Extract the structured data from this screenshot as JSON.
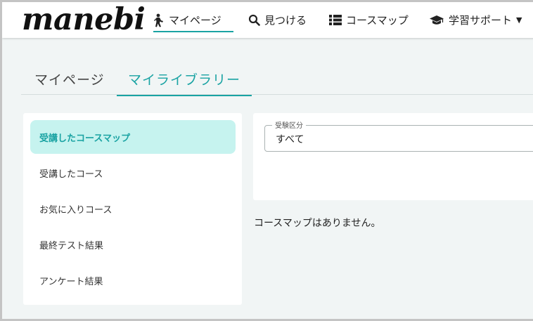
{
  "header": {
    "logo": "manebi",
    "nav": [
      {
        "label": "マイページ",
        "icon": "person-walking-icon",
        "active": true
      },
      {
        "label": "見つける",
        "icon": "search-icon",
        "active": false
      },
      {
        "label": "コースマップ",
        "icon": "list-icon",
        "active": false
      },
      {
        "label": "学習サポート",
        "icon": "graduation-cap-icon",
        "active": false,
        "dropdown": true
      }
    ]
  },
  "tabs": [
    {
      "label": "マイページ",
      "active": false
    },
    {
      "label": "マイライブラリー",
      "active": true
    }
  ],
  "sidebar": {
    "items": [
      {
        "label": "受講したコースマップ",
        "active": true
      },
      {
        "label": "受講したコース",
        "active": false
      },
      {
        "label": "お気に入りコース",
        "active": false
      },
      {
        "label": "最終テスト結果",
        "active": false
      },
      {
        "label": "アンケート結果",
        "active": false
      }
    ]
  },
  "filter": {
    "legend": "受験区分",
    "value": "すべて"
  },
  "main": {
    "empty_message": "コースマップはありません。"
  },
  "colors": {
    "accent": "#1aa3a3",
    "active_bg": "#c6f3ef",
    "page_bg": "#f1f5f5"
  }
}
